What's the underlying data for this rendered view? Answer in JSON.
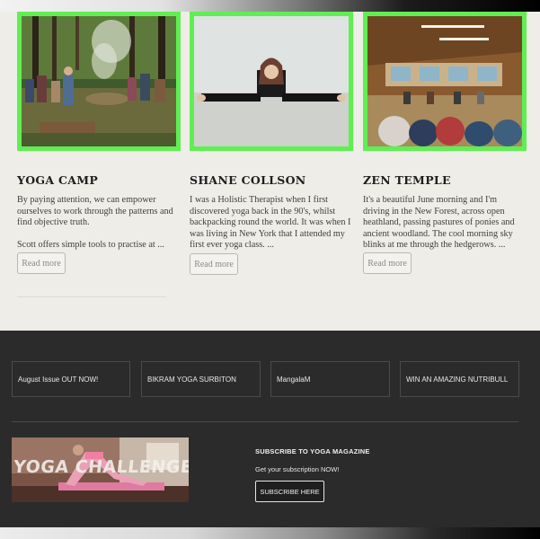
{
  "cards": [
    {
      "title": "YOGA CAMP",
      "image": "group-in-forest-photo",
      "paragraphs": [
        "By paying attention, we can empower ourselves to work through the patterns and find objective truth.",
        "Scott offers simple tools to practise at ..."
      ],
      "read_more": "Read more"
    },
    {
      "title": "SHANE COLLSON",
      "image": "woman-doing-splits-photo",
      "paragraphs": [
        "I was a Holistic Therapist when I first discovered yoga back in the 90's, whilst backpacking round the world. It was when I was living in New York that I attended my first ever yoga class. ..."
      ],
      "read_more": "Read more"
    },
    {
      "title": "ZEN TEMPLE",
      "image": "meditation-hall-photo",
      "paragraphs": [
        "It's a beautiful June morning and I'm driving in the New Forest, across open heathland, passing pastures of ponies and ancient woodland. The cool morning sky blinks at me through the hedgerows. ..."
      ],
      "read_more": "Read more"
    }
  ],
  "footer": {
    "links": [
      "August Issue OUT NOW!",
      "BIKRAM YOGA SURBITON",
      "MangalaM",
      "WIN AN AMAZING NUTRIBULL"
    ],
    "banner_text": "YOGA CHALLENGE",
    "subscribe": {
      "title": "SUBSCRIBE TO YOGA MAGAZINE",
      "text": "Get your subscription NOW!",
      "button": "SUBSCRIBE HERE"
    }
  },
  "colors": {
    "card_border": "#5fef52",
    "content_background": "#eeede8",
    "footer_background": "#2b2b2b"
  }
}
